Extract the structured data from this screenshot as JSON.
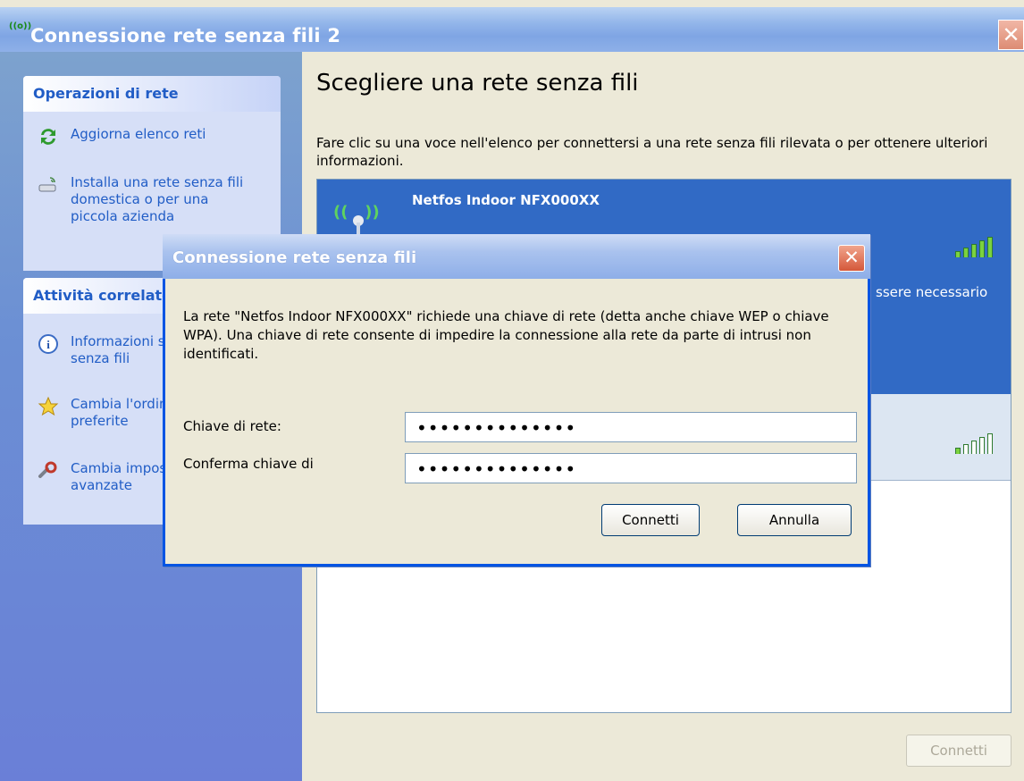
{
  "window": {
    "title": "Connessione rete senza fili 2",
    "title_icon": "wireless-icon",
    "close_glyph": "✕"
  },
  "left_panel": {
    "network_tasks": {
      "heading": "Operazioni di rete",
      "items": [
        {
          "label": "Aggiorna elenco reti",
          "icon": "refresh-icon"
        },
        {
          "label_lines": [
            "Installa una rete senza fili",
            "domestica o per una",
            "piccola azienda"
          ],
          "icon": "setup-wizard-icon"
        }
      ]
    },
    "related_tasks": {
      "heading": "Attività correlate",
      "items": [
        {
          "label_lines": [
            "Informazioni sulle reti",
            "senza fili"
          ],
          "icon": "info-icon"
        },
        {
          "label_lines": [
            "Cambia l'ordine delle reti",
            "preferite"
          ],
          "icon": "star-icon"
        },
        {
          "label_lines": [
            "Cambia impostazioni",
            "avanzate"
          ],
          "icon": "settings-icon"
        }
      ]
    }
  },
  "main": {
    "heading": "Scegliere una rete senza fili",
    "description": "Fare clic su una voce nell'elenco per connettersi a una rete senza fili rilevata o per ottenere ulteriori informazioni.",
    "networks": [
      {
        "name": "Netfos Indoor NFX000XX",
        "note": "ssere necessario",
        "signal_bars": 5,
        "signal_level": 1.0,
        "selected": true
      },
      {
        "name": "",
        "signal_bars": 5,
        "signal_level": 0.2,
        "selected": false
      }
    ],
    "connect_button": "Connetti"
  },
  "dialog": {
    "title": "Connessione rete senza fili",
    "close_glyph": "✕",
    "message": "La rete \"Netfos Indoor NFX000XX\" richiede una chiave di rete (detta anche chiave WEP o chiave WPA). Una chiave di rete consente di impedire la connessione alla rete da parte di intrusi non identificati.",
    "key_label": "Chiave di rete:",
    "key_value": "••••••••••••••",
    "confirm_label": "Conferma chiave di",
    "confirm_value": "••••••••••••••",
    "connect_button": "Connetti",
    "cancel_button": "Annulla"
  },
  "colors": {
    "xp_blue_title": "#7fa5e4",
    "selected_row": "#316ac5",
    "task_link": "#215dc6",
    "close_red": "#d4583a",
    "window_bg": "#ECE9D8"
  }
}
